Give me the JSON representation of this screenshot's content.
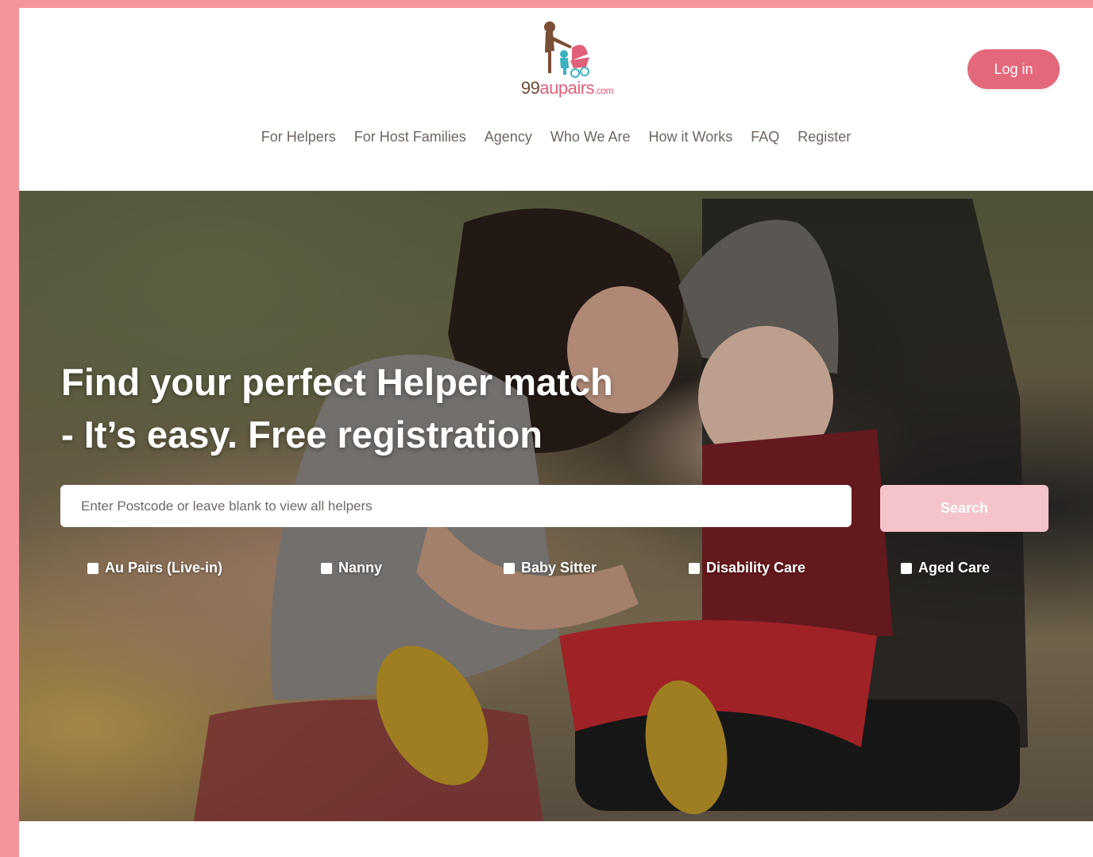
{
  "logo": {
    "part1": "99",
    "part2": "aupairs",
    "part3": ".com"
  },
  "header": {
    "login_label": "Log in"
  },
  "nav": [
    "For Helpers",
    "For Host Families",
    "Agency",
    "Who We Are",
    "How it Works",
    "FAQ",
    "Register"
  ],
  "hero": {
    "headline_line1": "Find your perfect Helper match",
    "headline_line2": "- It’s easy. Free registration",
    "search_placeholder": "Enter Postcode or leave blank to view all helpers",
    "search_label": "Search",
    "filters": [
      "Au Pairs (Live-in)",
      "Nanny",
      "Baby Sitter",
      "Disability Care",
      "Aged Care"
    ]
  },
  "colors": {
    "accent": "#e4687c",
    "page_border": "#f4959c",
    "search_button": "#f5c4cb"
  }
}
